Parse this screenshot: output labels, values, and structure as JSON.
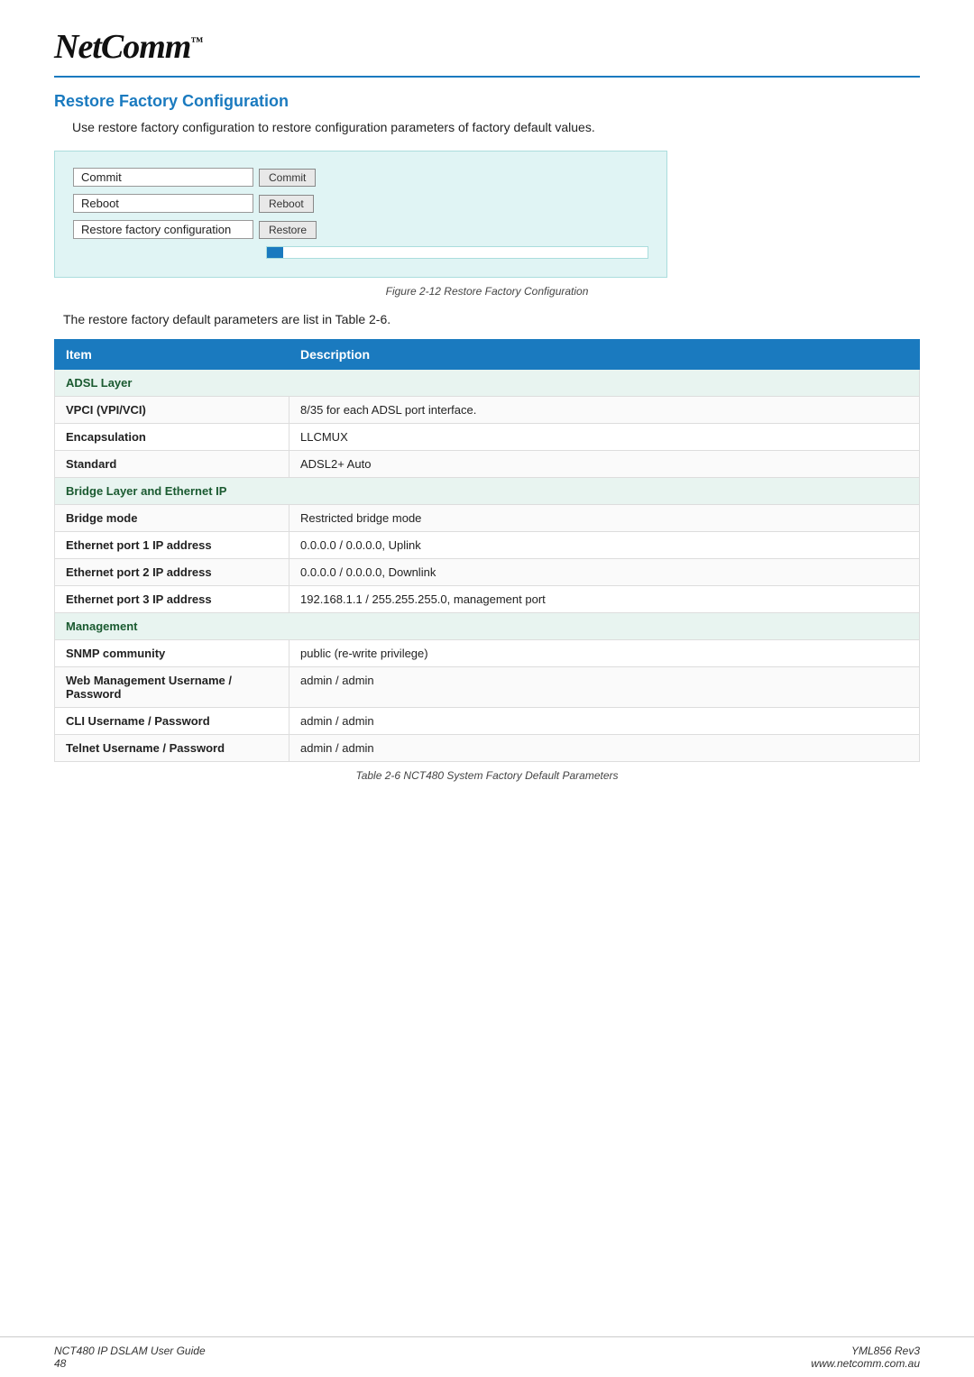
{
  "header": {
    "logo": "NetComm",
    "logo_tm": "™"
  },
  "page": {
    "title": "Restore Factory Configuration",
    "intro": "Use restore factory configuration to restore configuration parameters of factory default values.",
    "figure_caption": "Figure 2-12 Restore Factory Configuration",
    "summary": "The restore factory default parameters are list in Table 2-6.",
    "table_caption": "Table 2-6 NCT480 System Factory Default Parameters"
  },
  "config_panel": {
    "rows": [
      {
        "label": "Commit",
        "button": "Commit"
      },
      {
        "label": "Reboot",
        "button": "Reboot"
      },
      {
        "label": "Restore factory configuration",
        "button": "Restore"
      }
    ]
  },
  "table": {
    "headers": [
      "Item",
      "Description"
    ],
    "rows": [
      {
        "type": "section",
        "item": "ADSL Layer",
        "desc": ""
      },
      {
        "type": "data",
        "item": "VPCI (VPI/VCI)",
        "desc": "8/35 for each ADSL port interface."
      },
      {
        "type": "data",
        "item": "Encapsulation",
        "desc": "LLCMUX"
      },
      {
        "type": "data",
        "item": "Standard",
        "desc": "ADSL2+ Auto"
      },
      {
        "type": "section",
        "item": "Bridge Layer and Ethernet IP",
        "desc": ""
      },
      {
        "type": "data",
        "item": "Bridge mode",
        "desc": "Restricted bridge mode"
      },
      {
        "type": "data",
        "item": "Ethernet port 1 IP address",
        "desc": "0.0.0.0 / 0.0.0.0, Uplink"
      },
      {
        "type": "data",
        "item": "Ethernet port 2 IP address",
        "desc": "0.0.0.0 / 0.0.0.0, Downlink"
      },
      {
        "type": "data",
        "item": "Ethernet port 3 IP address",
        "desc": "192.168.1.1 / 255.255.255.0, management port"
      },
      {
        "type": "section",
        "item": "Management",
        "desc": ""
      },
      {
        "type": "data",
        "item": "SNMP community",
        "desc": "public (re-write privilege)"
      },
      {
        "type": "data",
        "item": "Web Management Username / Password",
        "desc": "admin / admin"
      },
      {
        "type": "data",
        "item": "CLI Username / Password",
        "desc": "admin / admin"
      },
      {
        "type": "data",
        "item": "Telnet Username / Password",
        "desc": "admin / admin"
      }
    ]
  },
  "footer": {
    "left_line1": "NCT480 IP DSLAM User Guide",
    "left_line2": "48",
    "right_line1": "YML856 Rev3",
    "right_line2": "www.netcomm.com.au"
  }
}
